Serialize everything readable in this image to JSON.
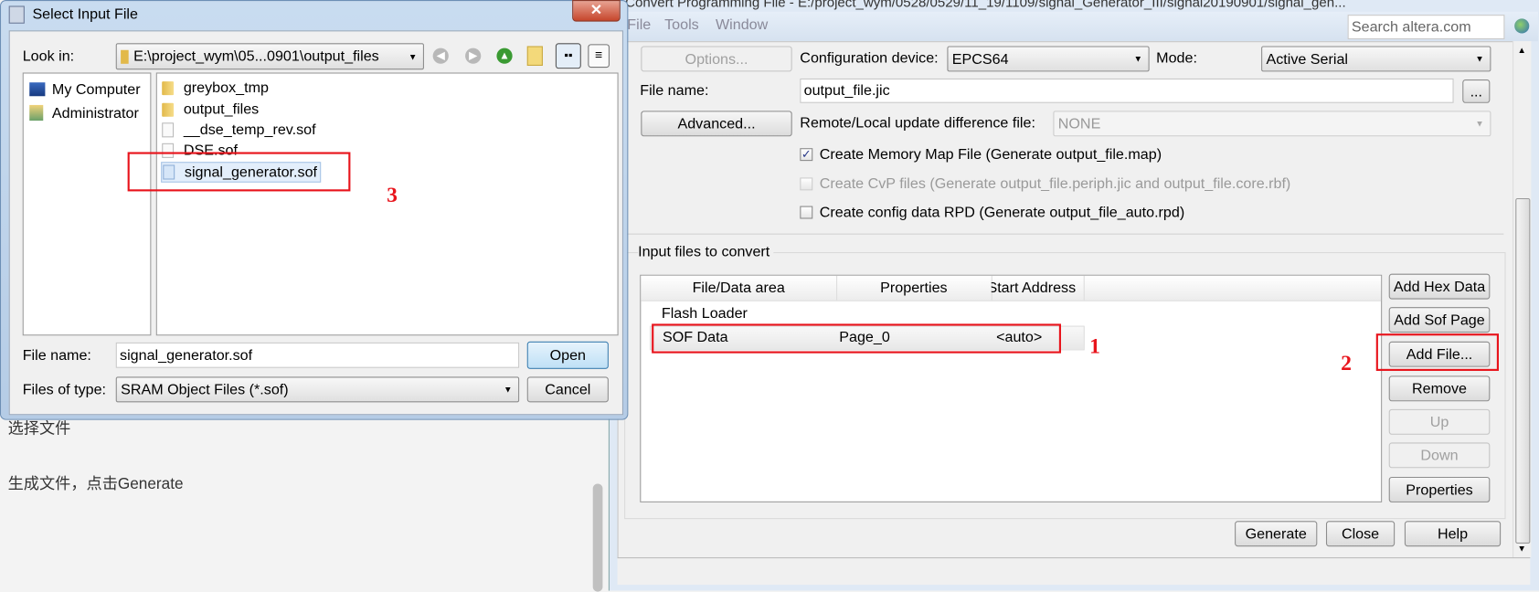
{
  "background_doc": {
    "line1": "选择文件",
    "line2": "生成文件，点击Generate"
  },
  "main_window": {
    "title": "Convert Programming File - E:/project_wym/0528/0529/11_19/1109/signal_Generator_III/signal20190901/signal_gen...",
    "menu": [
      "File",
      "Tools",
      "Window"
    ],
    "search_placeholder": "Search altera.com",
    "options_button": "Options...",
    "config_device_label": "Configuration device:",
    "config_device_value": "EPCS64",
    "mode_label": "Mode:",
    "mode_value": "Active Serial",
    "file_name_label": "File name:",
    "file_name_value": "output_file.jic",
    "browse_button": "...",
    "advanced_button": "Advanced...",
    "remote_label": "Remote/Local update difference file:",
    "remote_value": "NONE",
    "checkboxes": [
      {
        "label": "Create Memory Map File (Generate output_file.map)",
        "checked": true,
        "enabled": true
      },
      {
        "label": "Create CvP files (Generate output_file.periph.jic and output_file.core.rbf)",
        "checked": false,
        "enabled": false
      },
      {
        "label": "Create config data RPD (Generate output_file_auto.rpd)",
        "checked": false,
        "enabled": true
      }
    ],
    "input_group_label": "Input files to convert",
    "table": {
      "columns": [
        "File/Data area",
        "Properties",
        "Start Address"
      ],
      "rows": [
        {
          "area": "Flash Loader",
          "properties": "",
          "start": ""
        },
        {
          "area": "SOF Data",
          "properties": "Page_0",
          "start": "<auto>"
        }
      ]
    },
    "side_buttons": [
      "Add Hex Data",
      "Add Sof Page",
      "Add File...",
      "Remove",
      "Up",
      "Down",
      "Properties"
    ],
    "bottom_buttons": [
      "Generate",
      "Close",
      "Help"
    ]
  },
  "dialog": {
    "title": "Select Input File",
    "look_in_label": "Look in:",
    "look_in_value": "E:\\project_wym\\05...0901\\output_files",
    "places": [
      "My Computer",
      "Administrator"
    ],
    "files": [
      {
        "name": "greybox_tmp",
        "type": "folder"
      },
      {
        "name": "output_files",
        "type": "folder"
      },
      {
        "name": "__dse_temp_rev.sof",
        "type": "file"
      },
      {
        "name": "DSE.sof",
        "type": "file"
      },
      {
        "name": "signal_generator.sof",
        "type": "file",
        "selected": true
      }
    ],
    "file_name_label": "File name:",
    "file_name_value": "signal_generator.sof",
    "files_of_type_label": "Files of type:",
    "files_of_type_value": "SRAM Object Files (*.sof)",
    "open_button": "Open",
    "cancel_button": "Cancel"
  },
  "annotations": {
    "step1": "1",
    "step2": "2",
    "step3": "3",
    "color": "#e8141c"
  }
}
